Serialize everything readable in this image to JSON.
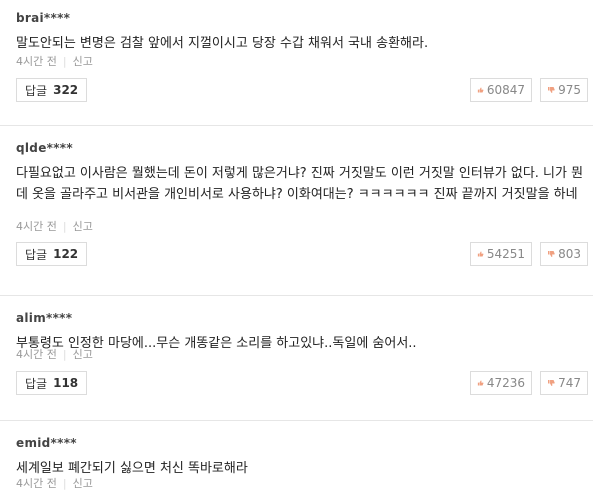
{
  "labels": {
    "reply": "답글",
    "report": "신고",
    "sep": "|"
  },
  "comments": [
    {
      "user": "brai****",
      "text": "말도안되는 변명은 검찰 앞에서 지껄이시고 당장 수갑 채워서 국내 송환해라.",
      "time": "4시간 전",
      "replies": "322",
      "likes": "60847",
      "dislikes": "975"
    },
    {
      "user": "qlde****",
      "text": "다필요없고 이사람은 뭘했는데 돈이 저렇게 많은거냐? 진짜 거짓말도 이런 거짓말 인터뷰가 없다. 니가 뭔데 옷을 골라주고 비서관을 개인비서로 사용하냐? 이화여대는? ㅋㅋㅋㅋㅋㅋ 진짜 끝까지 거짓말을 하네",
      "time": "4시간 전",
      "replies": "122",
      "likes": "54251",
      "dislikes": "803"
    },
    {
      "user": "alim****",
      "text": "부통령도 인정한 마당에...무슨 개똥같은 소리를 하고있냐..독일에 숨어서..",
      "time": "4시간 전",
      "replies": "118",
      "likes": "47236",
      "dislikes": "747"
    },
    {
      "user": "emid****",
      "text": "세계일보 폐간되기 싫으면 처신 똑바로해라",
      "time": "4시간 전"
    }
  ],
  "icons": {
    "like": "thumbs-up-icon",
    "dislike": "thumbs-down-icon"
  },
  "colors": {
    "like": "#f0a080",
    "dislike": "#f0a080"
  }
}
